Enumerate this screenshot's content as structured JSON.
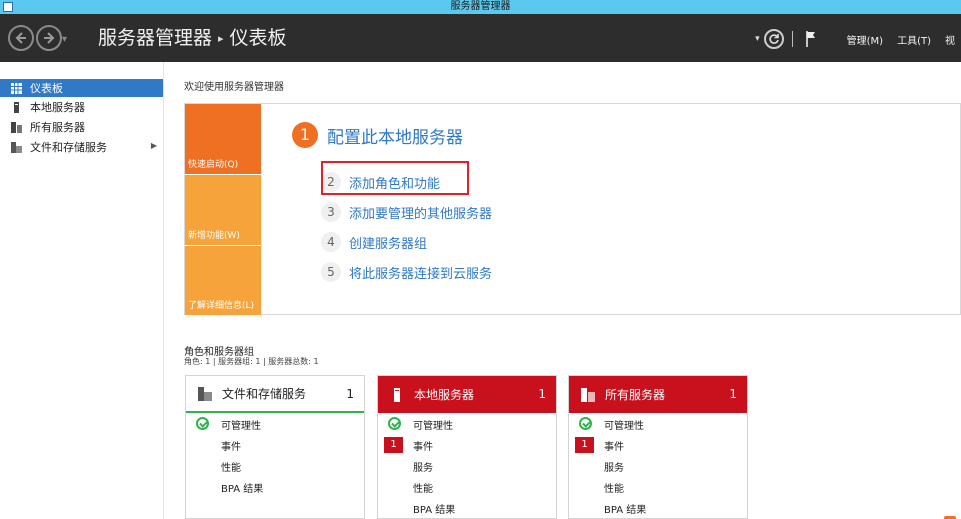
{
  "window": {
    "title": "服务器管理器"
  },
  "header": {
    "breadcrumb_root": "服务器管理器",
    "breadcrumb_sep": "▸",
    "breadcrumb_current": "仪表板",
    "menu": {
      "manage": "管理(M)",
      "tools": "工具(T)",
      "view_cut": "视"
    }
  },
  "sidebar": {
    "items": [
      {
        "label": "仪表板",
        "icon": "dashboard-icon",
        "active": true
      },
      {
        "label": "本地服务器",
        "icon": "server-icon"
      },
      {
        "label": "所有服务器",
        "icon": "servers-icon"
      },
      {
        "label": "文件和存储服务",
        "icon": "file-storage-icon",
        "has_submenu": true
      }
    ]
  },
  "main": {
    "welcome": "欢迎使用服务器管理器",
    "tiles": {
      "quick_start": "快速启动(Q)",
      "whats_new": "新增功能(W)",
      "learn_more": "了解详细信息(L)"
    },
    "steps": [
      {
        "num": "1",
        "text": "配置此本地服务器"
      },
      {
        "num": "2",
        "text": "添加角色和功能"
      },
      {
        "num": "3",
        "text": "添加要管理的其他服务器"
      },
      {
        "num": "4",
        "text": "创建服务器组"
      },
      {
        "num": "5",
        "text": "将此服务器连接到云服务"
      }
    ],
    "roles": {
      "title": "角色和服务器组",
      "subtitle": "角色: 1 | 服务器组: 1 | 服务器总数: 1",
      "cards": [
        {
          "title": "文件和存储服务",
          "count": "1",
          "rows": [
            "可管理性",
            "事件",
            "性能",
            "BPA 结果"
          ]
        },
        {
          "title": "本地服务器",
          "count": "1",
          "rows": [
            "可管理性",
            "事件",
            "服务",
            "性能",
            "BPA 结果"
          ],
          "event_badge": "1"
        },
        {
          "title": "所有服务器",
          "count": "1",
          "rows": [
            "可管理性",
            "事件",
            "服务",
            "性能",
            "BPA 结果"
          ],
          "event_badge": "1"
        }
      ]
    }
  },
  "colors": {
    "accent_orange": "#f07023",
    "tile_light": "#f6a33b",
    "link_blue": "#2f79c6",
    "alert_red": "#c8111d",
    "ok_green": "#2fb34a",
    "highlight_red": "#e0202a"
  }
}
